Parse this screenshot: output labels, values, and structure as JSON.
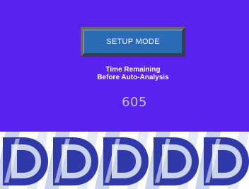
{
  "setup_button": {
    "label": "SETUP MODE"
  },
  "time_remaining": {
    "line1": "Time Remaining",
    "line2": "Before Auto-Analysis",
    "value": "605"
  },
  "colors": {
    "panel_background": "#5a22ee",
    "button_face": "#2b6ab4",
    "logo_dark": "#2f3aa8",
    "logo_light": "#c9d3ec"
  },
  "logo_band": {
    "icon": "d-logo-icon",
    "repeat_count": 5
  }
}
